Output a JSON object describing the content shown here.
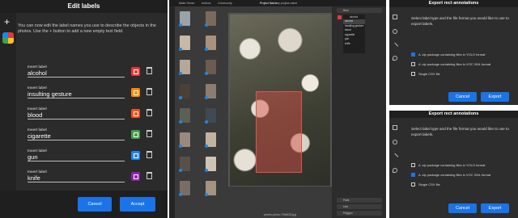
{
  "edit_labels": {
    "title": "Edit labels",
    "plus": "+",
    "description": "You can now edit the label names you use to describe the objects in the photos. Use the + button to add a new empty text field.",
    "insert_label_caption": "Insert label",
    "labels": [
      {
        "value": "alcohol",
        "color": "#e53935"
      },
      {
        "value": "insulting gesture",
        "color": "#fb8c00"
      },
      {
        "value": "blood",
        "color": "#f4511e"
      },
      {
        "value": "cigarette",
        "color": "#43a047"
      },
      {
        "value": "gun",
        "color": "#1e88e5"
      },
      {
        "value": "knife",
        "color": "#8e24aa"
      }
    ],
    "cancel_label": "Cancel",
    "accept_label": "Accept"
  },
  "editor": {
    "menu": [
      "Make Sense",
      "Actions",
      "Community"
    ],
    "project_label": "Project Name:",
    "project_name": "my-project-name",
    "dropdown_selected": "alcohol",
    "dropdown_items": [
      "alcohol",
      "insulting gesture",
      "blood",
      "cigarette",
      "gun",
      "knife"
    ],
    "side_bars": [
      "Rect",
      "Point",
      "Line",
      "Polygon"
    ],
    "footer": "pexels-photo-7068632.jpg"
  },
  "export_top": {
    "title": "Export rect annotations",
    "question": "Select label type and the file format you would like to use to export labels.",
    "options": [
      {
        "text": "A .zip package containing files in YOLO format",
        "checked": true
      },
      {
        "text": "A .zip package containing files in VOC XML format",
        "checked": false
      },
      {
        "text": "Single CSV file",
        "checked": false
      }
    ],
    "cancel_label": "Cancel",
    "export_label": "Export"
  },
  "export_bottom": {
    "title": "Export rect annotations",
    "question": "Select label type and the file format you would like to use to export labels.",
    "options": [
      {
        "text": "A .zip package containing files in YOLO format",
        "checked": false
      },
      {
        "text": "A .zip package containing files in VOC XML format",
        "checked": true
      },
      {
        "text": "Single CSV file",
        "checked": false
      }
    ],
    "cancel_label": "Cancel",
    "export_label": "Export"
  }
}
